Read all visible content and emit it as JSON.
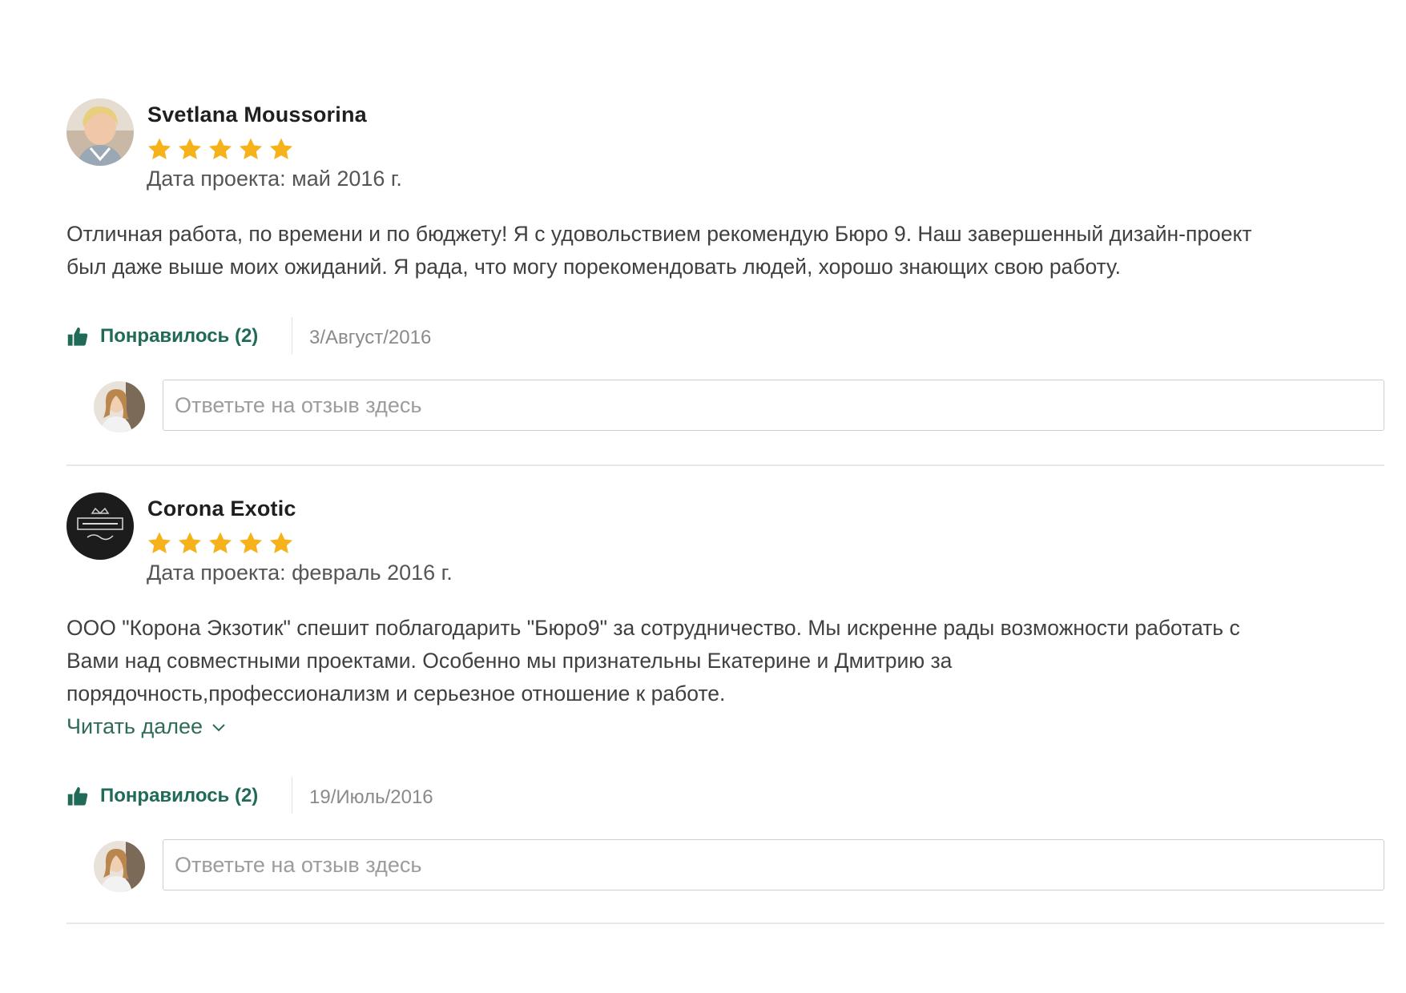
{
  "reviews": [
    {
      "author": "Svetlana Moussorina",
      "stars": 5,
      "project_date": "Дата проекта: май 2016 г.",
      "text_lines": [
        "Отличная работа, по времени и по бюджету! Я с удовольствием рекомендую Бюро 9. Наш завершенный дизайн-проект",
        "был даже выше моих ожиданий. Я рада, что могу порекомендовать людей, хорошо знающих свою работу."
      ],
      "like_label": "Понравилось (2)",
      "timestamp": "3/Август/2016",
      "reply_placeholder": "Ответьте на отзыв здесь"
    },
    {
      "author": "Corona Exotic",
      "stars": 5,
      "project_date": "Дата проекта: февраль 2016 г.",
      "text_lines": [
        "ООО \"Корона Экзотик\" спешит поблагодарить \"Бюро9\" за сотрудничество. Мы искренне рады возможности работать с",
        "Вами над совместными проектами. Особенно мы признательны Екатерине и Дмитрию за",
        "порядочность,профессионализм и  серьезное отношение к работе."
      ],
      "read_more": "Читать далее",
      "like_label": "Понравилось (2)",
      "timestamp": "19/Июль/2016",
      "reply_placeholder": "Ответьте на отзыв здесь"
    }
  ],
  "colors": {
    "star": "#f5b21b",
    "accent_green": "#1f6b58",
    "link": "#2f6b5a"
  },
  "icons": {
    "star": "star-icon",
    "like": "thumbs-up-icon",
    "read_more": "chevron-down-icon"
  }
}
